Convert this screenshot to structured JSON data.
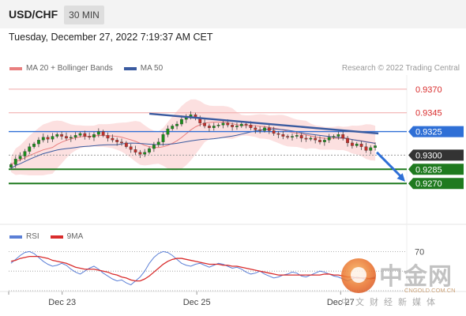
{
  "header": {
    "symbol": "USD/CHF",
    "timeframe": "30 MIN",
    "datetime": "Tuesday, December 27, 2022 7:19:37 AM CET"
  },
  "legend": {
    "ma20_label": "MA 20 + Bollinger Bands",
    "ma50_label": "MA 50",
    "ma20_color": "#e97f7f",
    "ma50_color": "#3a5ba0",
    "credit": "Research © 2022 Trading Central"
  },
  "rsi_legend": {
    "rsi_label": "RSI",
    "ma9_label": "9MA",
    "rsi_color": "#5b7fd6",
    "ma9_color": "#d92c2c"
  },
  "watermark": {
    "title": "中金网",
    "url": "CNGOLD.COM.CN",
    "subtitle": "中文财经新媒体"
  },
  "chart_data": [
    {
      "type": "candlestick",
      "title": "USD/CHF 30 MIN",
      "ylim": [
        0.924,
        0.9385
      ],
      "x_ticks": [
        "Dec 23",
        "Dec 25",
        "Dec 27"
      ],
      "levels": [
        {
          "label": "0.9370",
          "value": 0.937,
          "style": "resistance-light",
          "color": "#e98f8f"
        },
        {
          "label": "0.9345",
          "value": 0.9345,
          "style": "resistance-light",
          "color": "#e98f8f"
        },
        {
          "label": "0.9325",
          "value": 0.9325,
          "style": "pivot",
          "color": "#2f6fd6"
        },
        {
          "label": "0.9300",
          "value": 0.93,
          "style": "last-price",
          "color": "#333333"
        },
        {
          "label": "0.9285",
          "value": 0.9285,
          "style": "support",
          "color": "#1f7a1f"
        },
        {
          "label": "0.9270",
          "value": 0.927,
          "style": "support",
          "color": "#1f7a1f"
        }
      ],
      "close_series": [
        0.929,
        0.9296,
        0.9299,
        0.9304,
        0.9309,
        0.9312,
        0.9316,
        0.9319,
        0.9317,
        0.932,
        0.9322,
        0.932,
        0.9318,
        0.9319,
        0.9321,
        0.9323,
        0.932,
        0.9319,
        0.9322,
        0.9325,
        0.9321,
        0.9318,
        0.9316,
        0.9314,
        0.9313,
        0.9309,
        0.9306,
        0.9303,
        0.9301,
        0.9303,
        0.9307,
        0.9311,
        0.9314,
        0.9322,
        0.9328,
        0.9331,
        0.9333,
        0.9338,
        0.9341,
        0.9343,
        0.9339,
        0.9334,
        0.9331,
        0.9329,
        0.9331,
        0.9332,
        0.9334,
        0.9332,
        0.933,
        0.9331,
        0.9333,
        0.9332,
        0.9329,
        0.9327,
        0.9326,
        0.9329,
        0.9326,
        0.9323,
        0.9322,
        0.932,
        0.9319,
        0.932,
        0.9321,
        0.9318,
        0.9317,
        0.9318,
        0.9316,
        0.9314,
        0.9316,
        0.9319,
        0.932,
        0.9322,
        0.9318,
        0.9313,
        0.931,
        0.9312,
        0.9309,
        0.9305,
        0.9308,
        0.931
      ],
      "trendline": {
        "from": 0.9344,
        "to": 0.9323,
        "color": "#3a5ba0"
      },
      "projection": {
        "from": 0.9303,
        "to": 0.9272,
        "color": "#2f6fd6"
      }
    },
    {
      "type": "line",
      "title": "RSI",
      "ylim": [
        30,
        80
      ],
      "reference_levels": [
        70,
        50,
        30
      ],
      "reference_labels": [
        "70"
      ],
      "series": [
        {
          "name": "RSI",
          "color": "#5b7fd6",
          "values": [
            58,
            62,
            66,
            69,
            70,
            68,
            64,
            60,
            57,
            55,
            56,
            58,
            56,
            52,
            49,
            47,
            50,
            53,
            55,
            52,
            48,
            45,
            42,
            40,
            41,
            38,
            36,
            40,
            44,
            50,
            58,
            64,
            68,
            70,
            69,
            66,
            62,
            58,
            56,
            55,
            57,
            58,
            56,
            54,
            56,
            58,
            57,
            55,
            53,
            54,
            52,
            49,
            47,
            48,
            50,
            47,
            45,
            43,
            44,
            46,
            47,
            49,
            48,
            45,
            44,
            46,
            48,
            50,
            49,
            47,
            45,
            44,
            42,
            40,
            42,
            44,
            43,
            41,
            43,
            44
          ]
        },
        {
          "name": "9MA",
          "color": "#d92c2c",
          "values": [
            60,
            61,
            63,
            64,
            65,
            65,
            65,
            64,
            63,
            61,
            60,
            59,
            58,
            56,
            54,
            53,
            52,
            52,
            52,
            51,
            50,
            49,
            47,
            46,
            44,
            43,
            41,
            40,
            40,
            42,
            45,
            49,
            53,
            57,
            60,
            62,
            63,
            63,
            62,
            61,
            60,
            59,
            58,
            57,
            57,
            57,
            56,
            56,
            55,
            55,
            54,
            53,
            52,
            51,
            50,
            49,
            48,
            47,
            46,
            46,
            46,
            46,
            46,
            46,
            46,
            46,
            46,
            46,
            47,
            47,
            46,
            46,
            45,
            44,
            44,
            43,
            43,
            43,
            42,
            43
          ]
        }
      ]
    }
  ]
}
